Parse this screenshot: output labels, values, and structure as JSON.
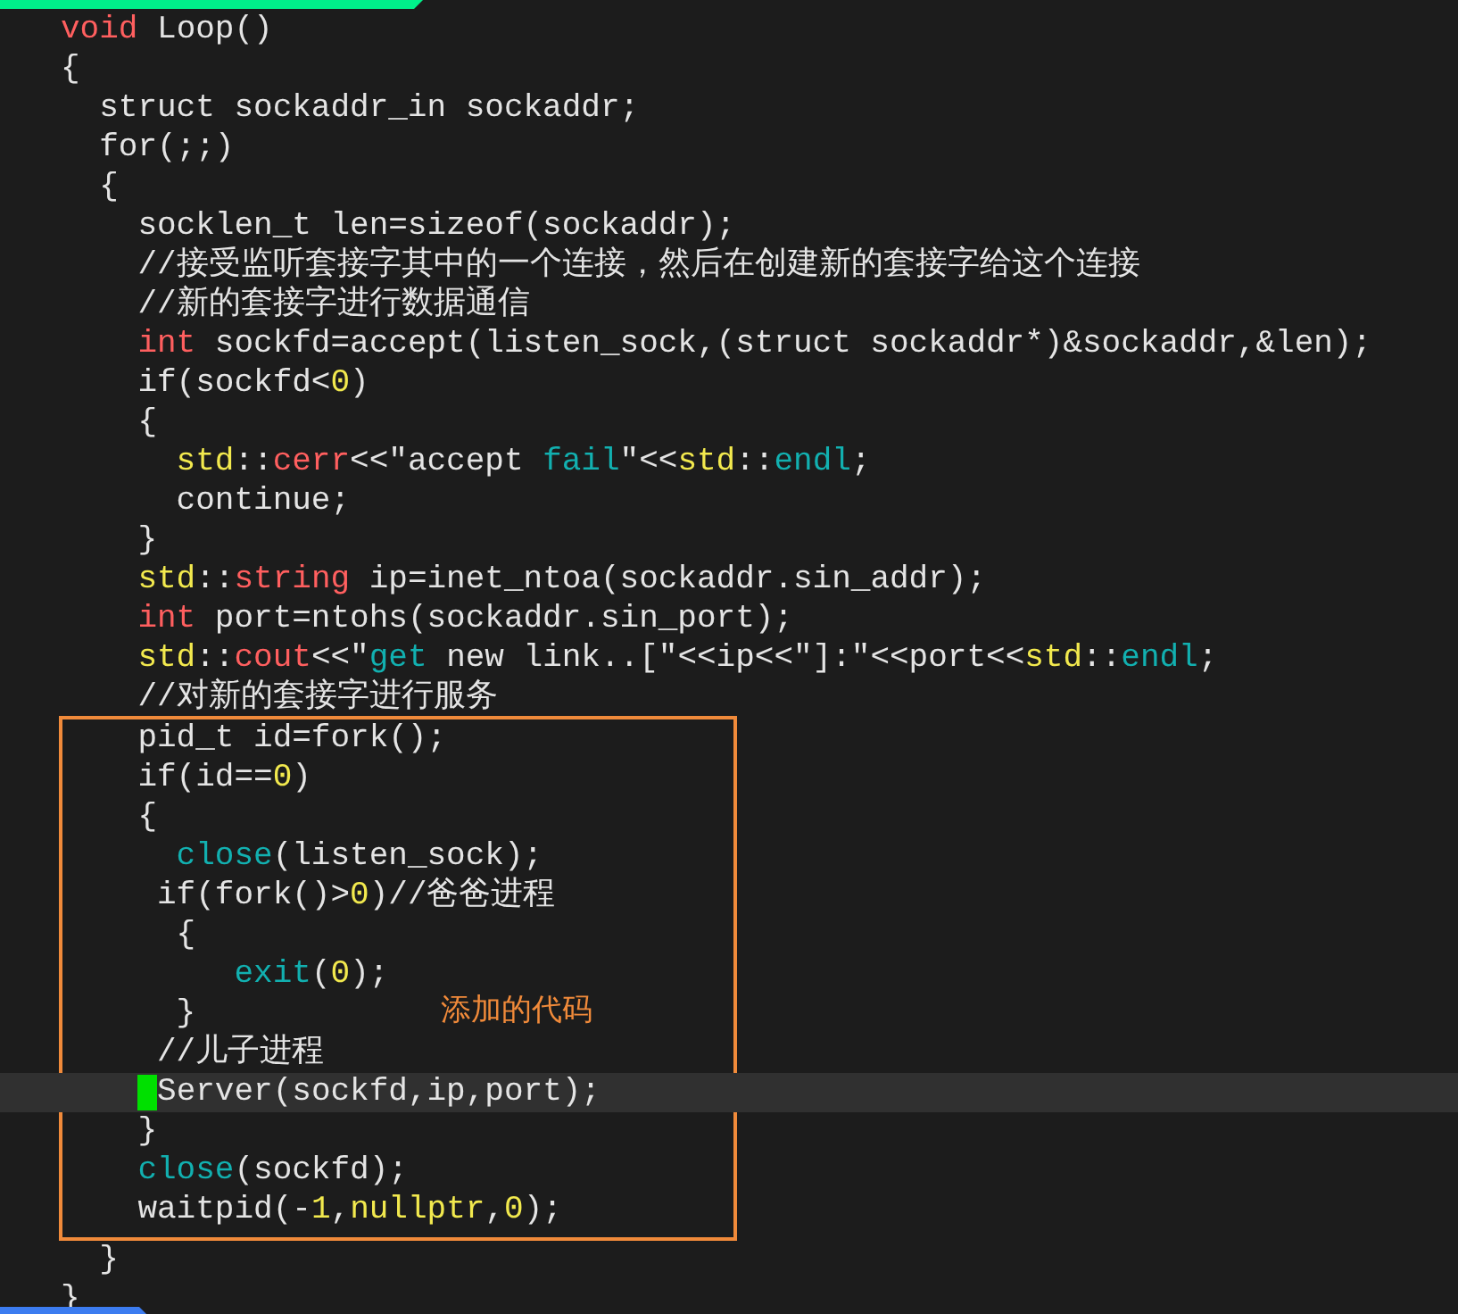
{
  "editor": {
    "annotation": {
      "label": "添加的代码"
    },
    "lines": [
      {
        "segments": [
          {
            "text": "void",
            "kind": "keyword"
          },
          {
            "text": " Loop()",
            "kind": "plain"
          }
        ],
        "current": false,
        "cursor": false,
        "in_annotation": false
      },
      {
        "segments": [
          {
            "text": "{",
            "kind": "plain"
          }
        ],
        "current": false,
        "cursor": false,
        "in_annotation": false
      },
      {
        "segments": [
          {
            "text": "  struct sockaddr_in sockaddr;",
            "kind": "plain"
          }
        ],
        "current": false,
        "cursor": false,
        "in_annotation": false
      },
      {
        "segments": [
          {
            "text": "  for(;;)",
            "kind": "plain"
          }
        ],
        "current": false,
        "cursor": false,
        "in_annotation": false
      },
      {
        "segments": [
          {
            "text": "  {",
            "kind": "plain"
          }
        ],
        "current": false,
        "cursor": false,
        "in_annotation": false
      },
      {
        "segments": [
          {
            "text": "    socklen_t len=sizeof(sockaddr);",
            "kind": "plain"
          }
        ],
        "current": false,
        "cursor": false,
        "in_annotation": false
      },
      {
        "segments": [
          {
            "text": "    //接受监听套接字其中的一个连接，然后在创建新的套接字给这个连接",
            "kind": "plain"
          }
        ],
        "current": false,
        "cursor": false,
        "in_annotation": false
      },
      {
        "segments": [
          {
            "text": "    //新的套接字进行数据通信",
            "kind": "plain"
          }
        ],
        "current": false,
        "cursor": false,
        "in_annotation": false
      },
      {
        "segments": [
          {
            "text": "    int",
            "kind": "keyword"
          },
          {
            "text": " sockfd=accept(listen_sock,(struct sockaddr*)&sockaddr,&len);",
            "kind": "plain"
          }
        ],
        "current": false,
        "cursor": false,
        "in_annotation": false
      },
      {
        "segments": [
          {
            "text": "    if(sockfd<",
            "kind": "plain"
          },
          {
            "text": "0",
            "kind": "number"
          },
          {
            "text": ")",
            "kind": "plain"
          }
        ],
        "current": false,
        "cursor": false,
        "in_annotation": false
      },
      {
        "segments": [
          {
            "text": "    {",
            "kind": "plain"
          }
        ],
        "current": false,
        "cursor": false,
        "in_annotation": false
      },
      {
        "segments": [
          {
            "text": "      std",
            "kind": "type"
          },
          {
            "text": "::",
            "kind": "plain"
          },
          {
            "text": "cerr",
            "kind": "keyword"
          },
          {
            "text": "<<\"accept ",
            "kind": "plain"
          },
          {
            "text": "fail",
            "kind": "function"
          },
          {
            "text": "\"<<",
            "kind": "plain"
          },
          {
            "text": "std",
            "kind": "type"
          },
          {
            "text": "::",
            "kind": "plain"
          },
          {
            "text": "endl",
            "kind": "function"
          },
          {
            "text": ";",
            "kind": "plain"
          }
        ],
        "current": false,
        "cursor": false,
        "in_annotation": false
      },
      {
        "segments": [
          {
            "text": "      continue;",
            "kind": "plain"
          }
        ],
        "current": false,
        "cursor": false,
        "in_annotation": false
      },
      {
        "segments": [
          {
            "text": "    }",
            "kind": "plain"
          }
        ],
        "current": false,
        "cursor": false,
        "in_annotation": false
      },
      {
        "segments": [
          {
            "text": "    std",
            "kind": "type"
          },
          {
            "text": "::",
            "kind": "plain"
          },
          {
            "text": "string",
            "kind": "keyword"
          },
          {
            "text": " ip=inet_ntoa(sockaddr.sin_addr);",
            "kind": "plain"
          }
        ],
        "current": false,
        "cursor": false,
        "in_annotation": false
      },
      {
        "segments": [
          {
            "text": "    int",
            "kind": "keyword"
          },
          {
            "text": " port=ntohs(sockaddr.sin_port);",
            "kind": "plain"
          }
        ],
        "current": false,
        "cursor": false,
        "in_annotation": false
      },
      {
        "segments": [
          {
            "text": "    std",
            "kind": "type"
          },
          {
            "text": "::",
            "kind": "plain"
          },
          {
            "text": "cout",
            "kind": "keyword"
          },
          {
            "text": "<<\"",
            "kind": "plain"
          },
          {
            "text": "get",
            "kind": "function"
          },
          {
            "text": " new link..[\"<<ip<<\"]:\"<<port<<",
            "kind": "plain"
          },
          {
            "text": "std",
            "kind": "type"
          },
          {
            "text": "::",
            "kind": "plain"
          },
          {
            "text": "endl",
            "kind": "function"
          },
          {
            "text": ";",
            "kind": "plain"
          }
        ],
        "current": false,
        "cursor": false,
        "in_annotation": false
      },
      {
        "segments": [
          {
            "text": "    //对新的套接字进行服务",
            "kind": "plain"
          }
        ],
        "current": false,
        "cursor": false,
        "in_annotation": false
      },
      {
        "segments": [
          {
            "text": "    pid_t id=fork();",
            "kind": "plain"
          }
        ],
        "current": false,
        "cursor": false,
        "in_annotation": true
      },
      {
        "segments": [
          {
            "text": "    if(id==",
            "kind": "plain"
          },
          {
            "text": "0",
            "kind": "number"
          },
          {
            "text": ")",
            "kind": "plain"
          }
        ],
        "current": false,
        "cursor": false,
        "in_annotation": true
      },
      {
        "segments": [
          {
            "text": "    {",
            "kind": "plain"
          }
        ],
        "current": false,
        "cursor": false,
        "in_annotation": true
      },
      {
        "segments": [
          {
            "text": "      close",
            "kind": "function"
          },
          {
            "text": "(listen_sock);",
            "kind": "plain"
          }
        ],
        "current": false,
        "cursor": false,
        "in_annotation": true
      },
      {
        "segments": [
          {
            "text": "     if(fork()>",
            "kind": "plain"
          },
          {
            "text": "0",
            "kind": "number"
          },
          {
            "text": ")//爸爸进程",
            "kind": "plain"
          }
        ],
        "current": false,
        "cursor": false,
        "in_annotation": true
      },
      {
        "segments": [
          {
            "text": "      {",
            "kind": "plain"
          }
        ],
        "current": false,
        "cursor": false,
        "in_annotation": true
      },
      {
        "segments": [
          {
            "text": "         exit",
            "kind": "function"
          },
          {
            "text": "(",
            "kind": "plain"
          },
          {
            "text": "0",
            "kind": "number"
          },
          {
            "text": ");",
            "kind": "plain"
          }
        ],
        "current": false,
        "cursor": false,
        "in_annotation": true
      },
      {
        "segments": [
          {
            "text": "      }",
            "kind": "plain"
          }
        ],
        "current": false,
        "cursor": false,
        "in_annotation": true
      },
      {
        "segments": [
          {
            "text": "     //儿子进程",
            "kind": "plain"
          }
        ],
        "current": false,
        "cursor": false,
        "in_annotation": true
      },
      {
        "segments": [
          {
            "text": "     Server(sockfd,ip,port);",
            "kind": "plain"
          }
        ],
        "current": true,
        "cursor": true,
        "in_annotation": true
      },
      {
        "segments": [
          {
            "text": "    }",
            "kind": "plain"
          }
        ],
        "current": false,
        "cursor": false,
        "in_annotation": true
      },
      {
        "segments": [
          {
            "text": "    close",
            "kind": "function"
          },
          {
            "text": "(sockfd);",
            "kind": "plain"
          }
        ],
        "current": false,
        "cursor": false,
        "in_annotation": true
      },
      {
        "segments": [
          {
            "text": "    waitpid(-",
            "kind": "plain"
          },
          {
            "text": "1",
            "kind": "number"
          },
          {
            "text": ",",
            "kind": "plain"
          },
          {
            "text": "nullptr",
            "kind": "number"
          },
          {
            "text": ",",
            "kind": "plain"
          },
          {
            "text": "0",
            "kind": "number"
          },
          {
            "text": ");",
            "kind": "plain"
          }
        ],
        "current": false,
        "cursor": false,
        "in_annotation": true
      },
      {
        "segments": [
          {
            "text": "  }",
            "kind": "plain"
          }
        ],
        "current": false,
        "cursor": false,
        "in_annotation": false
      },
      {
        "segments": [
          {
            "text": "}",
            "kind": "plain"
          }
        ],
        "current": false,
        "cursor": false,
        "in_annotation": false
      }
    ]
  }
}
